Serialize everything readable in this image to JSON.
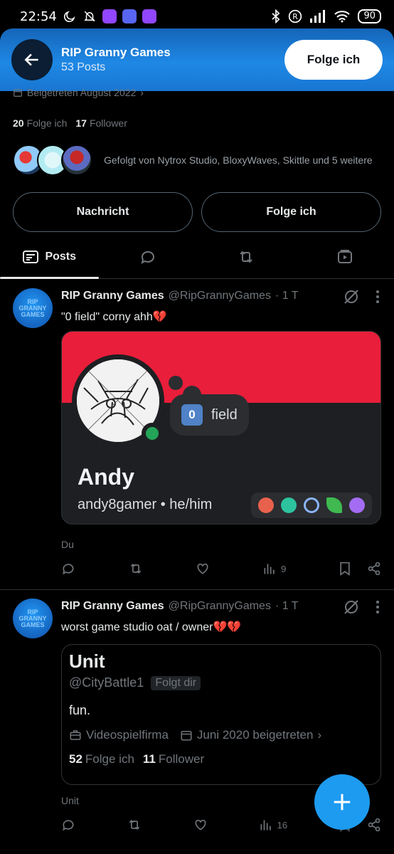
{
  "status_bar": {
    "time": "22:54",
    "battery": "90"
  },
  "header": {
    "title": "RIP Granny Games",
    "subtitle": "53 Posts",
    "follow_label": "Folge ich"
  },
  "profile": {
    "joined": "Beigetreten August 2022",
    "following_count": "20",
    "following_label": "Folge ich",
    "followers_count": "17",
    "followers_label": "Follower",
    "followed_by": "Gefolgt von Nytrox Studio, BloxyWaves, Skittle und 5 weitere",
    "message_button": "Nachricht",
    "follow_button": "Folge ich"
  },
  "tabs": [
    {
      "label": "Posts",
      "icon": "posts-icon"
    },
    {
      "label": "",
      "icon": "reply-icon"
    },
    {
      "label": "",
      "icon": "repost-icon"
    },
    {
      "label": "",
      "icon": "media-icon"
    }
  ],
  "posts": [
    {
      "avatar_text": "RIP GRANNY GAMES",
      "name": "RIP Granny Games",
      "handle": "@RipGrannyGames",
      "time": "· 1 T",
      "text": "\"0 field\" corny ahh💔",
      "card": {
        "status_emoji": "0",
        "status_text": "field",
        "display_name": "Andy",
        "username_line": "andy8gamer • he/him"
      },
      "label": "Du",
      "views": "9"
    },
    {
      "avatar_text": "RIP GRANNY GAMES",
      "name": "RIP Granny Games",
      "handle": "@RipGrannyGames",
      "time": "· 1 T",
      "text": "worst game studio oat / owner💔💔",
      "card": {
        "name": "Unit",
        "handle": "@CityBattle1",
        "follows_you": "Folgt dir",
        "bio": "fun.",
        "category": "Videospielfirma",
        "joined": "Juni 2020 beigetreten",
        "following_count": "52",
        "following_label": "Folge ich",
        "followers_count": "11",
        "followers_label": "Follower"
      },
      "label": "Unit",
      "views": "16"
    }
  ],
  "colors": {
    "accent": "#1d9bf0",
    "header": "#1e88e5",
    "banner": "#e91e3a"
  }
}
